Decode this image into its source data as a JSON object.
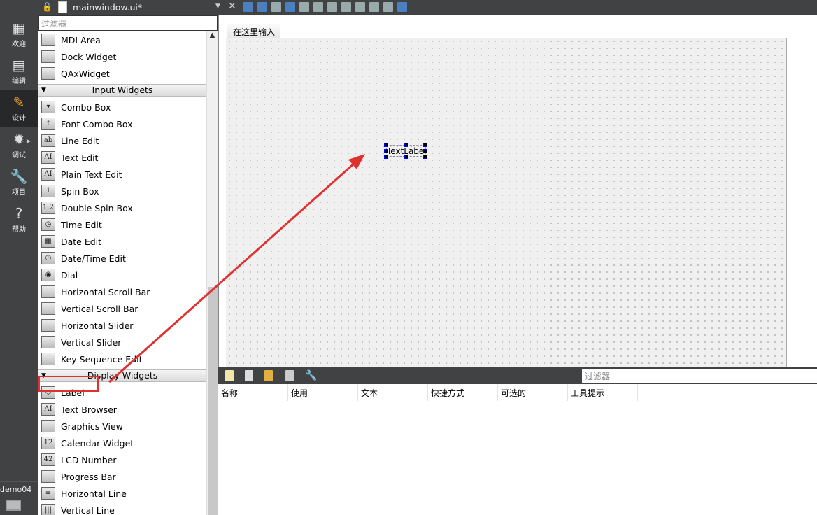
{
  "topbar": {
    "file_name": "mainwindow.ui*"
  },
  "modes": [
    {
      "label": "欢迎",
      "icon": "grid-icon"
    },
    {
      "label": "编辑",
      "icon": "document-icon"
    },
    {
      "label": "设计",
      "icon": "pencil-icon"
    },
    {
      "label": "调试",
      "icon": "bug-icon"
    },
    {
      "label": "项目",
      "icon": "wrench-icon"
    },
    {
      "label": "帮助",
      "icon": "help-icon"
    }
  ],
  "project": "demo04",
  "widget_box": {
    "filter_placeholder": "过滤器",
    "items_top": [
      {
        "label": "MDI Area"
      },
      {
        "label": "Dock Widget"
      },
      {
        "label": "QAxWidget"
      }
    ],
    "input_category": "Input Widgets",
    "input_items": [
      {
        "label": "Combo Box"
      },
      {
        "label": "Font Combo Box"
      },
      {
        "label": "Line Edit"
      },
      {
        "label": "Text Edit"
      },
      {
        "label": "Plain Text Edit"
      },
      {
        "label": "Spin Box"
      },
      {
        "label": "Double Spin Box"
      },
      {
        "label": "Time Edit"
      },
      {
        "label": "Date Edit"
      },
      {
        "label": "Date/Time Edit"
      },
      {
        "label": "Dial"
      },
      {
        "label": "Horizontal Scroll Bar"
      },
      {
        "label": "Vertical Scroll Bar"
      },
      {
        "label": "Horizontal Slider"
      },
      {
        "label": "Vertical Slider"
      },
      {
        "label": "Key Sequence Edit"
      }
    ],
    "display_category": "Display Widgets",
    "display_items": [
      {
        "label": "Label"
      },
      {
        "label": "Text Browser"
      },
      {
        "label": "Graphics View"
      },
      {
        "label": "Calendar Widget"
      },
      {
        "label": "LCD Number"
      },
      {
        "label": "Progress Bar"
      },
      {
        "label": "Horizontal Line"
      },
      {
        "label": "Vertical Line"
      }
    ]
  },
  "form": {
    "menu_placeholder": "在这里输入",
    "text_label": "TextLabel"
  },
  "action_editor": {
    "filter_placeholder": "过滤器",
    "columns": [
      "名称",
      "使用",
      "文本",
      "快捷方式",
      "可选的",
      "工具提示"
    ]
  },
  "colors": {
    "annotation": "#e03030",
    "sidebar": "#404244"
  }
}
